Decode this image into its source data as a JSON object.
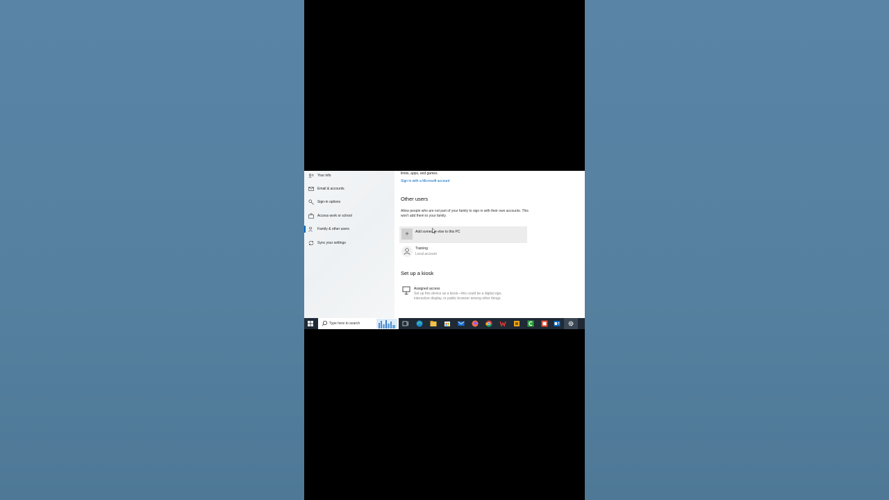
{
  "sidebar": {
    "items": [
      {
        "label": "Your info",
        "icon": "person-card-icon",
        "active": false
      },
      {
        "label": "Email & accounts",
        "icon": "mail-icon",
        "active": false
      },
      {
        "label": "Sign-in options",
        "icon": "key-icon",
        "active": false
      },
      {
        "label": "Access work or school",
        "icon": "briefcase-icon",
        "active": false
      },
      {
        "label": "Family & other users",
        "icon": "person-add-icon",
        "active": true
      },
      {
        "label": "Sync your settings",
        "icon": "sync-icon",
        "active": false
      }
    ]
  },
  "main": {
    "family_tail_text": "limits, apps, and games.",
    "signin_link": "Sign in with a Microsoft account",
    "other_users": {
      "heading": "Other users",
      "description": "Allow people who are not part of your family to sign in with their own accounts. This won't add them to your family.",
      "add_label": "Add someone else to this PC",
      "users": [
        {
          "name": "Training",
          "type": "Local account"
        }
      ]
    },
    "kiosk": {
      "heading": "Set up a kiosk",
      "title": "Assigned access",
      "description": "Set up this device as a kiosk—this could be a digital sign, interactive display, or public browser among other things."
    }
  },
  "taskbar": {
    "search_placeholder": "Type here to search",
    "apps": [
      "task-view-icon",
      "edge-icon",
      "file-explorer-icon",
      "store-icon",
      "mail-icon",
      "firefox-icon",
      "chrome-icon",
      "wps-icon",
      "folder-app-icon",
      "camtasia-icon",
      "red-app-icon",
      "outlook-icon",
      "settings-icon"
    ],
    "colors": {
      "taskbar_bg": "#1f2a35",
      "accent": "#0067c0"
    }
  }
}
